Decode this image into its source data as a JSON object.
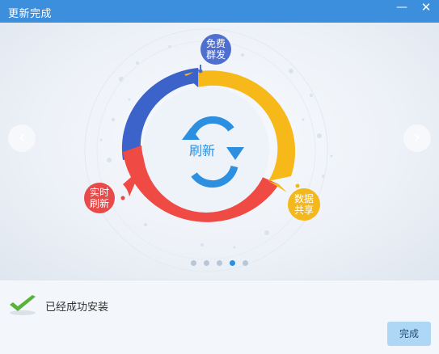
{
  "window": {
    "title": "更新完成"
  },
  "titlebar_icons": {
    "minimize": "minimize-icon",
    "close": "close-icon"
  },
  "hero": {
    "center_label": "刷新",
    "bubbles": {
      "free": "免费\n群发",
      "realtime": "实时\n刷新",
      "share": "数据\n共享"
    },
    "page_indicator": {
      "total": 5,
      "active": 4
    }
  },
  "footer": {
    "status": "已经成功安装",
    "done_label": "完成"
  },
  "colors": {
    "titlebar": "#3b8fdd",
    "ring_blue": "#3b63c9",
    "ring_red": "#f04a44",
    "ring_yellow": "#f7b81a",
    "refresh_icon": "#2d8fe0",
    "check": "#58b33a",
    "done_button": "#aed6f5"
  }
}
